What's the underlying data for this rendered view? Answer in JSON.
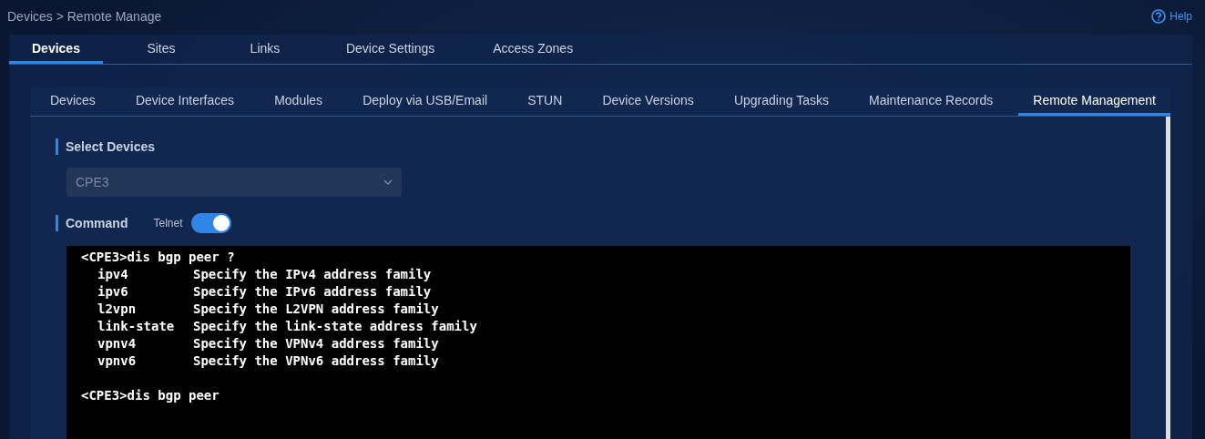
{
  "breadcrumb": "Devices > Remote Manage",
  "help": {
    "label": "Help"
  },
  "main_tabs": [
    {
      "label": "Devices",
      "selected": true
    },
    {
      "label": "Sites",
      "selected": false
    },
    {
      "label": "Links",
      "selected": false
    },
    {
      "label": "Device Settings",
      "selected": false
    },
    {
      "label": "Access Zones",
      "selected": false
    }
  ],
  "sub_tabs": [
    {
      "label": "Devices",
      "selected": false
    },
    {
      "label": "Device Interfaces",
      "selected": false
    },
    {
      "label": "Modules",
      "selected": false
    },
    {
      "label": "Deploy via USB/Email",
      "selected": false
    },
    {
      "label": "STUN",
      "selected": false
    },
    {
      "label": "Device Versions",
      "selected": false
    },
    {
      "label": "Upgrading Tasks",
      "selected": false
    },
    {
      "label": "Maintenance Records",
      "selected": false
    },
    {
      "label": "Remote Management",
      "selected": true
    }
  ],
  "select_devices": {
    "title": "Select Devices",
    "value": "CPE3"
  },
  "command": {
    "title": "Command",
    "toggle_label": "Telnet",
    "on": true
  },
  "terminal": [
    {
      "kind": "prompt",
      "text": "<CPE3>dis bgp peer ?"
    },
    {
      "kind": "option",
      "keyword": "ipv4",
      "description": "Specify the IPv4 address family"
    },
    {
      "kind": "option",
      "keyword": "ipv6",
      "description": "Specify the IPv6 address family"
    },
    {
      "kind": "option",
      "keyword": "l2vpn",
      "description": "Specify the L2VPN address family"
    },
    {
      "kind": "option",
      "keyword": "link-state",
      "description": "Specify the link-state address family"
    },
    {
      "kind": "option",
      "keyword": "vpnv4",
      "description": "Specify the VPNv4 address family"
    },
    {
      "kind": "option",
      "keyword": "vpnv6",
      "description": "Specify the VPNv6 address family"
    },
    {
      "kind": "prompt",
      "text": "<CPE3>dis bgp peer"
    }
  ]
}
